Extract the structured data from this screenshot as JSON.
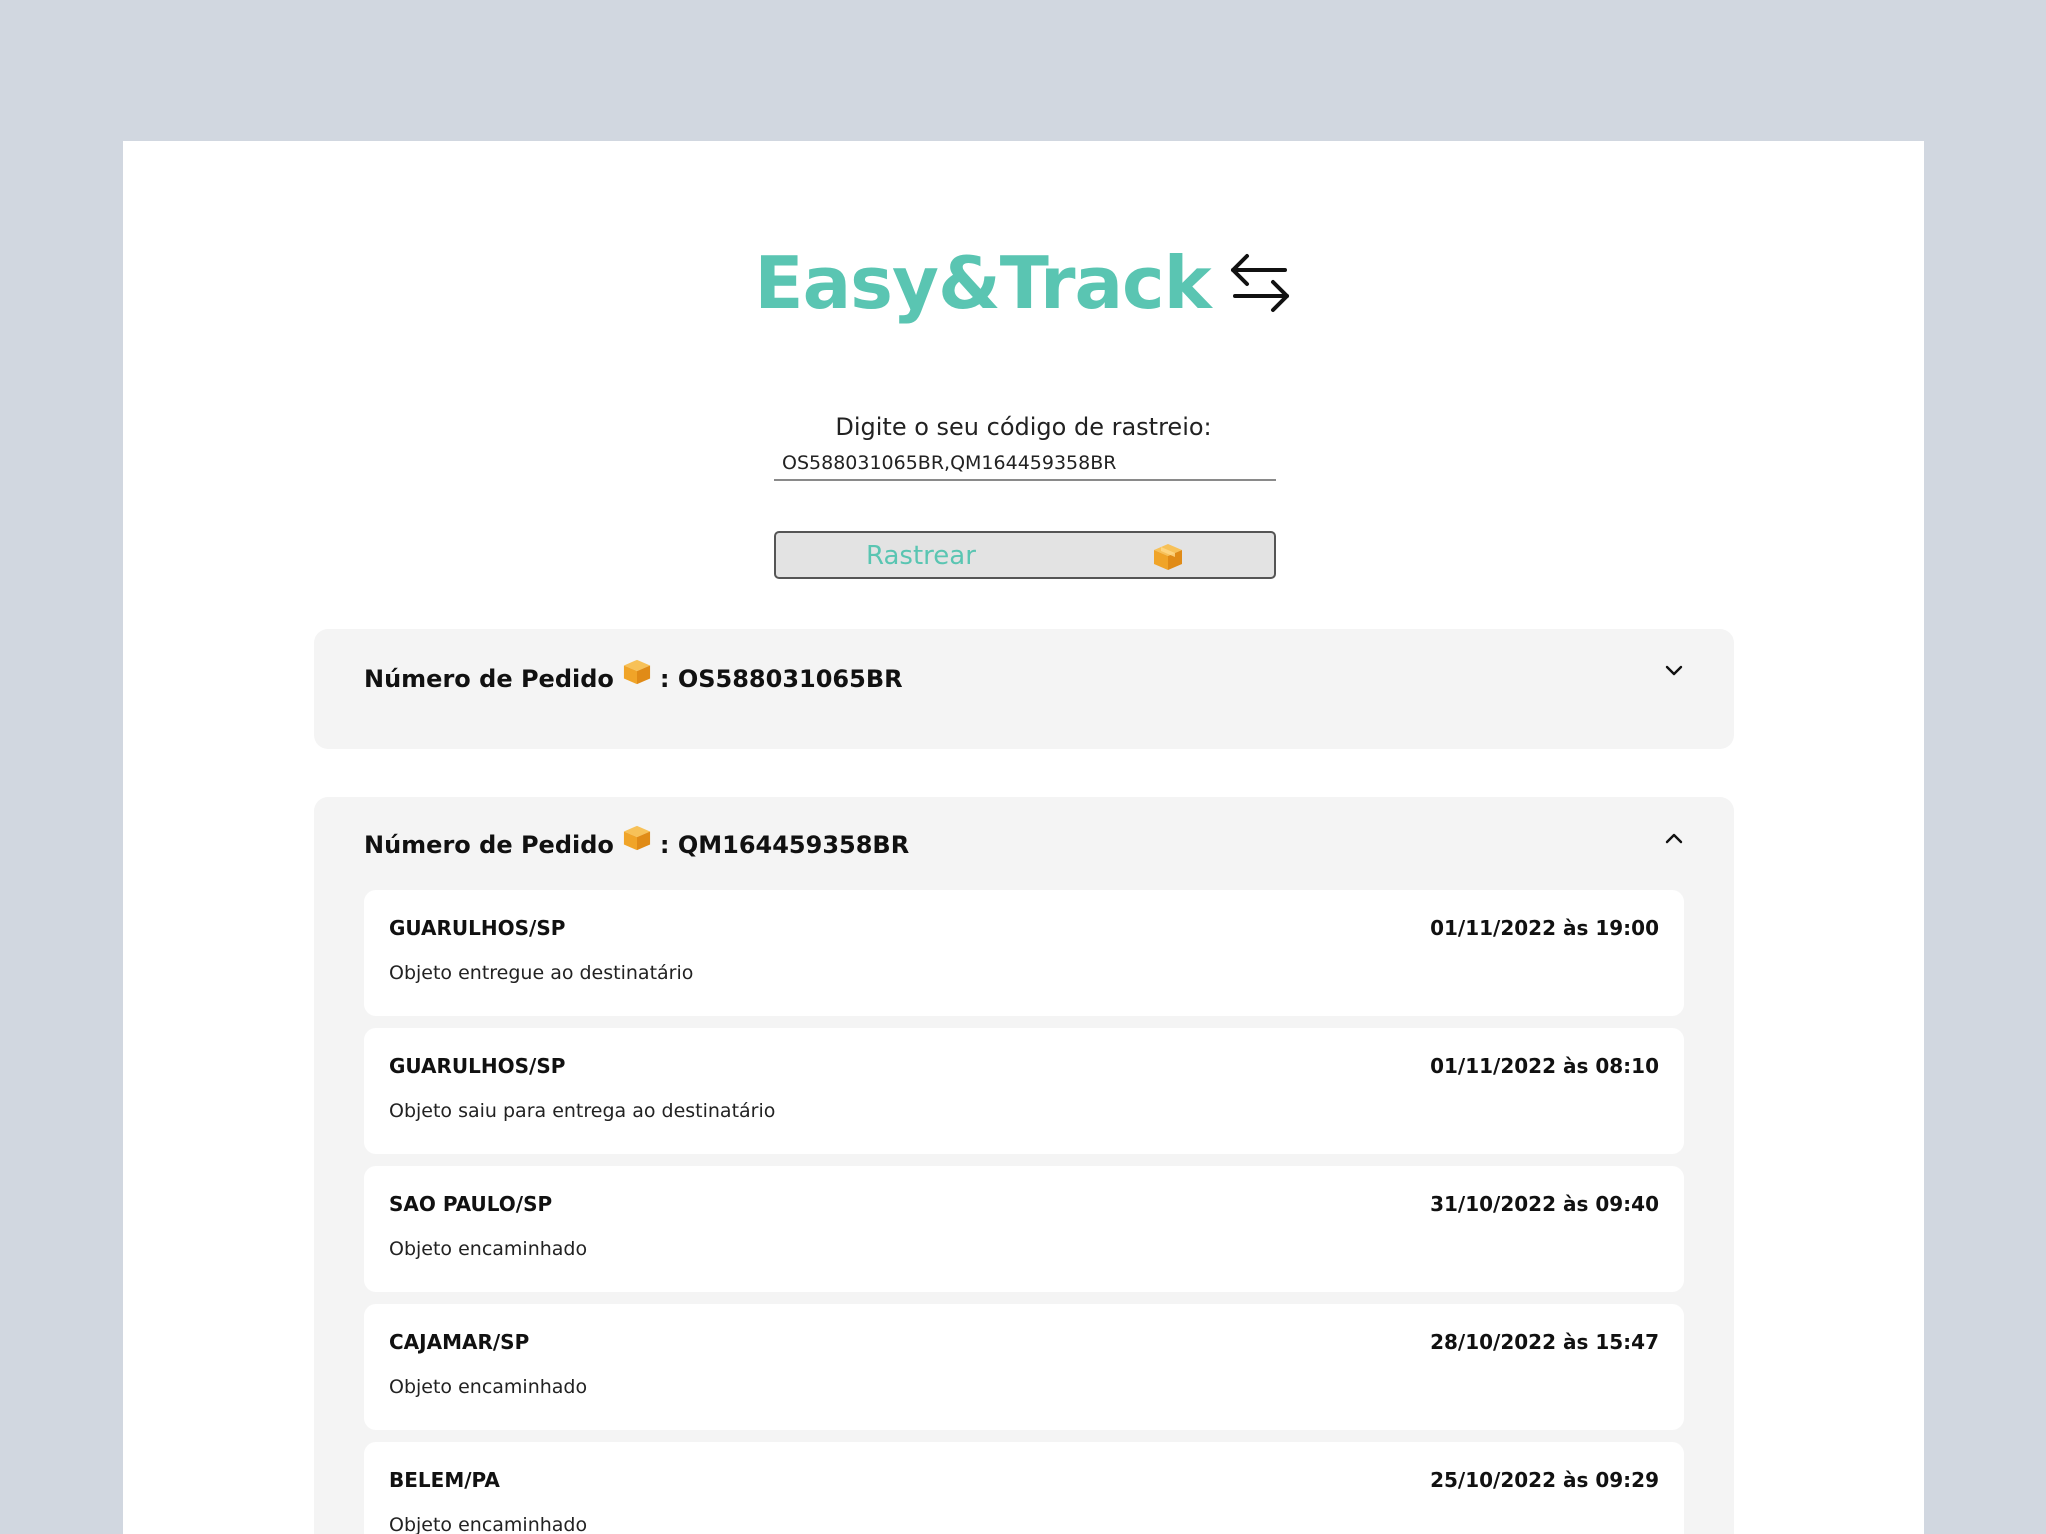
{
  "app": {
    "logo_text": "Easy&Track",
    "logo_icon": "swap-arrows-icon",
    "accent_color": "#5ac5b2"
  },
  "search": {
    "label": "Digite o seu código de rastreio:",
    "value": "OS588031065BR,QM164459358BR",
    "button_label": "Rastrear",
    "button_icon": "package-icon"
  },
  "orders": [
    {
      "label": "Número de Pedido",
      "code": ": OS588031065BR",
      "state": "collapsed",
      "toggle_icon": "chevron-down-icon"
    },
    {
      "label": "Número de Pedido",
      "code": ": QM164459358BR",
      "state": "expanded",
      "toggle_icon": "chevron-up-icon",
      "events": [
        {
          "place": "GUARULHOS/SP",
          "date": "01/11/2022 às 19:00",
          "description": "Objeto entregue ao destinatário"
        },
        {
          "place": "GUARULHOS/SP",
          "date": "01/11/2022 às 08:10",
          "description": "Objeto saiu para entrega ao destinatário"
        },
        {
          "place": "SAO PAULO/SP",
          "date": "31/10/2022 às 09:40",
          "description": "Objeto encaminhado"
        },
        {
          "place": "CAJAMAR/SP",
          "date": "28/10/2022 às 15:47",
          "description": "Objeto encaminhado"
        },
        {
          "place": "BELEM/PA",
          "date": "25/10/2022 às 09:29",
          "description": "Objeto encaminhado"
        }
      ]
    }
  ]
}
